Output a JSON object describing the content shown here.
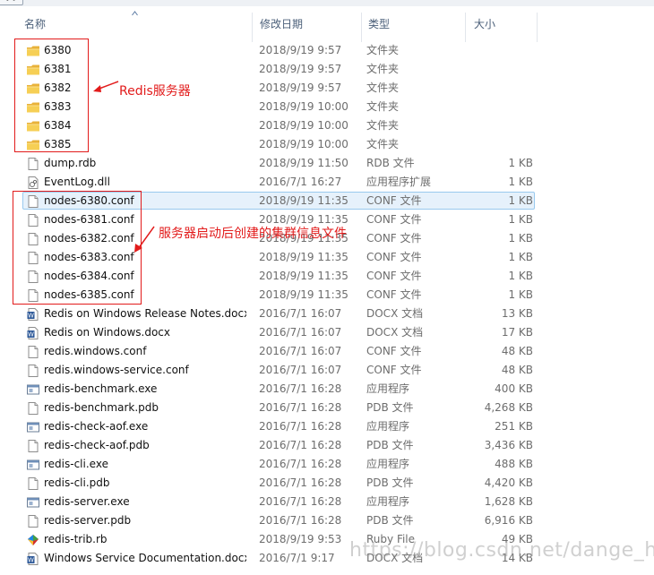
{
  "window": {
    "tab_stub": "夹"
  },
  "columns": {
    "name": "名称",
    "date": "修改日期",
    "type": "类型",
    "size": "大小"
  },
  "files": [
    {
      "name": "6380",
      "date": "2018/9/19 9:57",
      "type": "文件夹",
      "size": "",
      "icon": "folder-icon"
    },
    {
      "name": "6381",
      "date": "2018/9/19 9:57",
      "type": "文件夹",
      "size": "",
      "icon": "folder-icon"
    },
    {
      "name": "6382",
      "date": "2018/9/19 9:57",
      "type": "文件夹",
      "size": "",
      "icon": "folder-icon"
    },
    {
      "name": "6383",
      "date": "2018/9/19 10:00",
      "type": "文件夹",
      "size": "",
      "icon": "folder-icon"
    },
    {
      "name": "6384",
      "date": "2018/9/19 10:00",
      "type": "文件夹",
      "size": "",
      "icon": "folder-icon"
    },
    {
      "name": "6385",
      "date": "2018/9/19 10:00",
      "type": "文件夹",
      "size": "",
      "icon": "folder-icon"
    },
    {
      "name": "dump.rdb",
      "date": "2018/9/19 11:50",
      "type": "RDB 文件",
      "size": "1 KB",
      "icon": "file-icon"
    },
    {
      "name": "EventLog.dll",
      "date": "2016/7/1 16:27",
      "type": "应用程序扩展",
      "size": "1 KB",
      "icon": "dll-icon"
    },
    {
      "name": "nodes-6380.conf",
      "date": "2018/9/19 11:35",
      "type": "CONF 文件",
      "size": "1 KB",
      "icon": "file-icon"
    },
    {
      "name": "nodes-6381.conf",
      "date": "2018/9/19 11:35",
      "type": "CONF 文件",
      "size": "1 KB",
      "icon": "file-icon"
    },
    {
      "name": "nodes-6382.conf",
      "date": "2018/9/19 11:35",
      "type": "CONF 文件",
      "size": "1 KB",
      "icon": "file-icon"
    },
    {
      "name": "nodes-6383.conf",
      "date": "2018/9/19 11:35",
      "type": "CONF 文件",
      "size": "1 KB",
      "icon": "file-icon"
    },
    {
      "name": "nodes-6384.conf",
      "date": "2018/9/19 11:35",
      "type": "CONF 文件",
      "size": "1 KB",
      "icon": "file-icon"
    },
    {
      "name": "nodes-6385.conf",
      "date": "2018/9/19 11:35",
      "type": "CONF 文件",
      "size": "1 KB",
      "icon": "file-icon"
    },
    {
      "name": "Redis on Windows Release Notes.docx",
      "date": "2016/7/1 16:07",
      "type": "DOCX 文档",
      "size": "13 KB",
      "icon": "docx-icon"
    },
    {
      "name": "Redis on Windows.docx",
      "date": "2016/7/1 16:07",
      "type": "DOCX 文档",
      "size": "17 KB",
      "icon": "docx-icon"
    },
    {
      "name": "redis.windows.conf",
      "date": "2016/7/1 16:07",
      "type": "CONF 文件",
      "size": "48 KB",
      "icon": "file-icon"
    },
    {
      "name": "redis.windows-service.conf",
      "date": "2016/7/1 16:07",
      "type": "CONF 文件",
      "size": "48 KB",
      "icon": "file-icon"
    },
    {
      "name": "redis-benchmark.exe",
      "date": "2016/7/1 16:28",
      "type": "应用程序",
      "size": "400 KB",
      "icon": "exe-icon"
    },
    {
      "name": "redis-benchmark.pdb",
      "date": "2016/7/1 16:28",
      "type": "PDB 文件",
      "size": "4,268 KB",
      "icon": "file-icon"
    },
    {
      "name": "redis-check-aof.exe",
      "date": "2016/7/1 16:28",
      "type": "应用程序",
      "size": "251 KB",
      "icon": "exe-icon"
    },
    {
      "name": "redis-check-aof.pdb",
      "date": "2016/7/1 16:28",
      "type": "PDB 文件",
      "size": "3,436 KB",
      "icon": "file-icon"
    },
    {
      "name": "redis-cli.exe",
      "date": "2016/7/1 16:28",
      "type": "应用程序",
      "size": "488 KB",
      "icon": "exe-icon"
    },
    {
      "name": "redis-cli.pdb",
      "date": "2016/7/1 16:28",
      "type": "PDB 文件",
      "size": "4,420 KB",
      "icon": "file-icon"
    },
    {
      "name": "redis-server.exe",
      "date": "2016/7/1 16:28",
      "type": "应用程序",
      "size": "1,628 KB",
      "icon": "exe-icon"
    },
    {
      "name": "redis-server.pdb",
      "date": "2016/7/1 16:28",
      "type": "PDB 文件",
      "size": "6,916 KB",
      "icon": "file-icon"
    },
    {
      "name": "redis-trib.rb",
      "date": "2018/9/19 9:53",
      "type": "Ruby File",
      "size": "49 KB",
      "icon": "ruby-icon"
    },
    {
      "name": "Windows Service Documentation.docx",
      "date": "2016/7/1 9:17",
      "type": "DOCX 文档",
      "size": "14 KB",
      "icon": "docx-icon"
    }
  ],
  "selected_index": 8,
  "annotations": {
    "servers_label": "Redis服务器",
    "cluster_label": "服务器启动后创建的集群信息文件",
    "color": "#e21b1b"
  },
  "watermark": "https://blog.csdn.net/dange_h"
}
